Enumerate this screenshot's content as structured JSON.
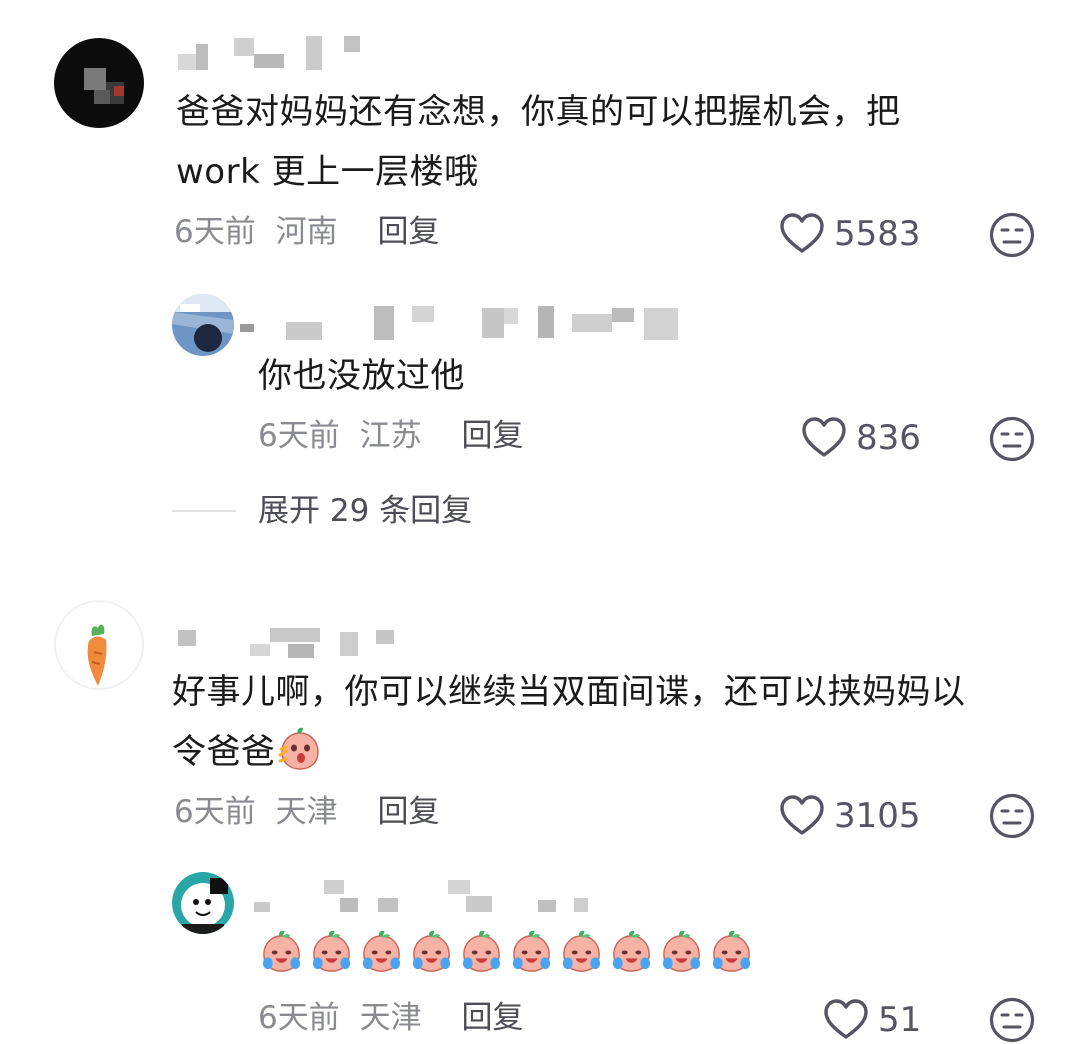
{
  "comments": [
    {
      "text_line1": "爸爸对妈妈还有念想，你真的可以把握机会，把",
      "text_line2": "work 更上一层楼哦",
      "time": "6天前",
      "location": "河南",
      "reply_label": "回复",
      "likes": "5583",
      "reply": {
        "text": "你也没放过他",
        "time": "6天前",
        "location": "江苏",
        "reply_label": "回复",
        "likes": "836"
      },
      "expand_label": "展开 29 条回复"
    },
    {
      "text_line1": "好事儿啊，你可以继续当双面间谍，还可以挟妈妈以",
      "text_line2": "令爸爸",
      "time": "6天前",
      "location": "天津",
      "reply_label": "回复",
      "likes": "3105",
      "reply": {
        "time": "6天前",
        "location": "天津",
        "reply_label": "回复",
        "likes": "51",
        "emoji_icon": "crying-peach-emoji",
        "emoji_count": 10
      }
    }
  ],
  "icons": {
    "like": "heart-outline-icon",
    "reaction": "neutral-face-icon",
    "inline_emoji": "shocked-peach-emoji"
  },
  "colors": {
    "text": "#1a1a1a",
    "meta": "#8a8b91",
    "icon": "#545560",
    "peach": "#f6a79b",
    "leaf": "#3dae5e"
  }
}
